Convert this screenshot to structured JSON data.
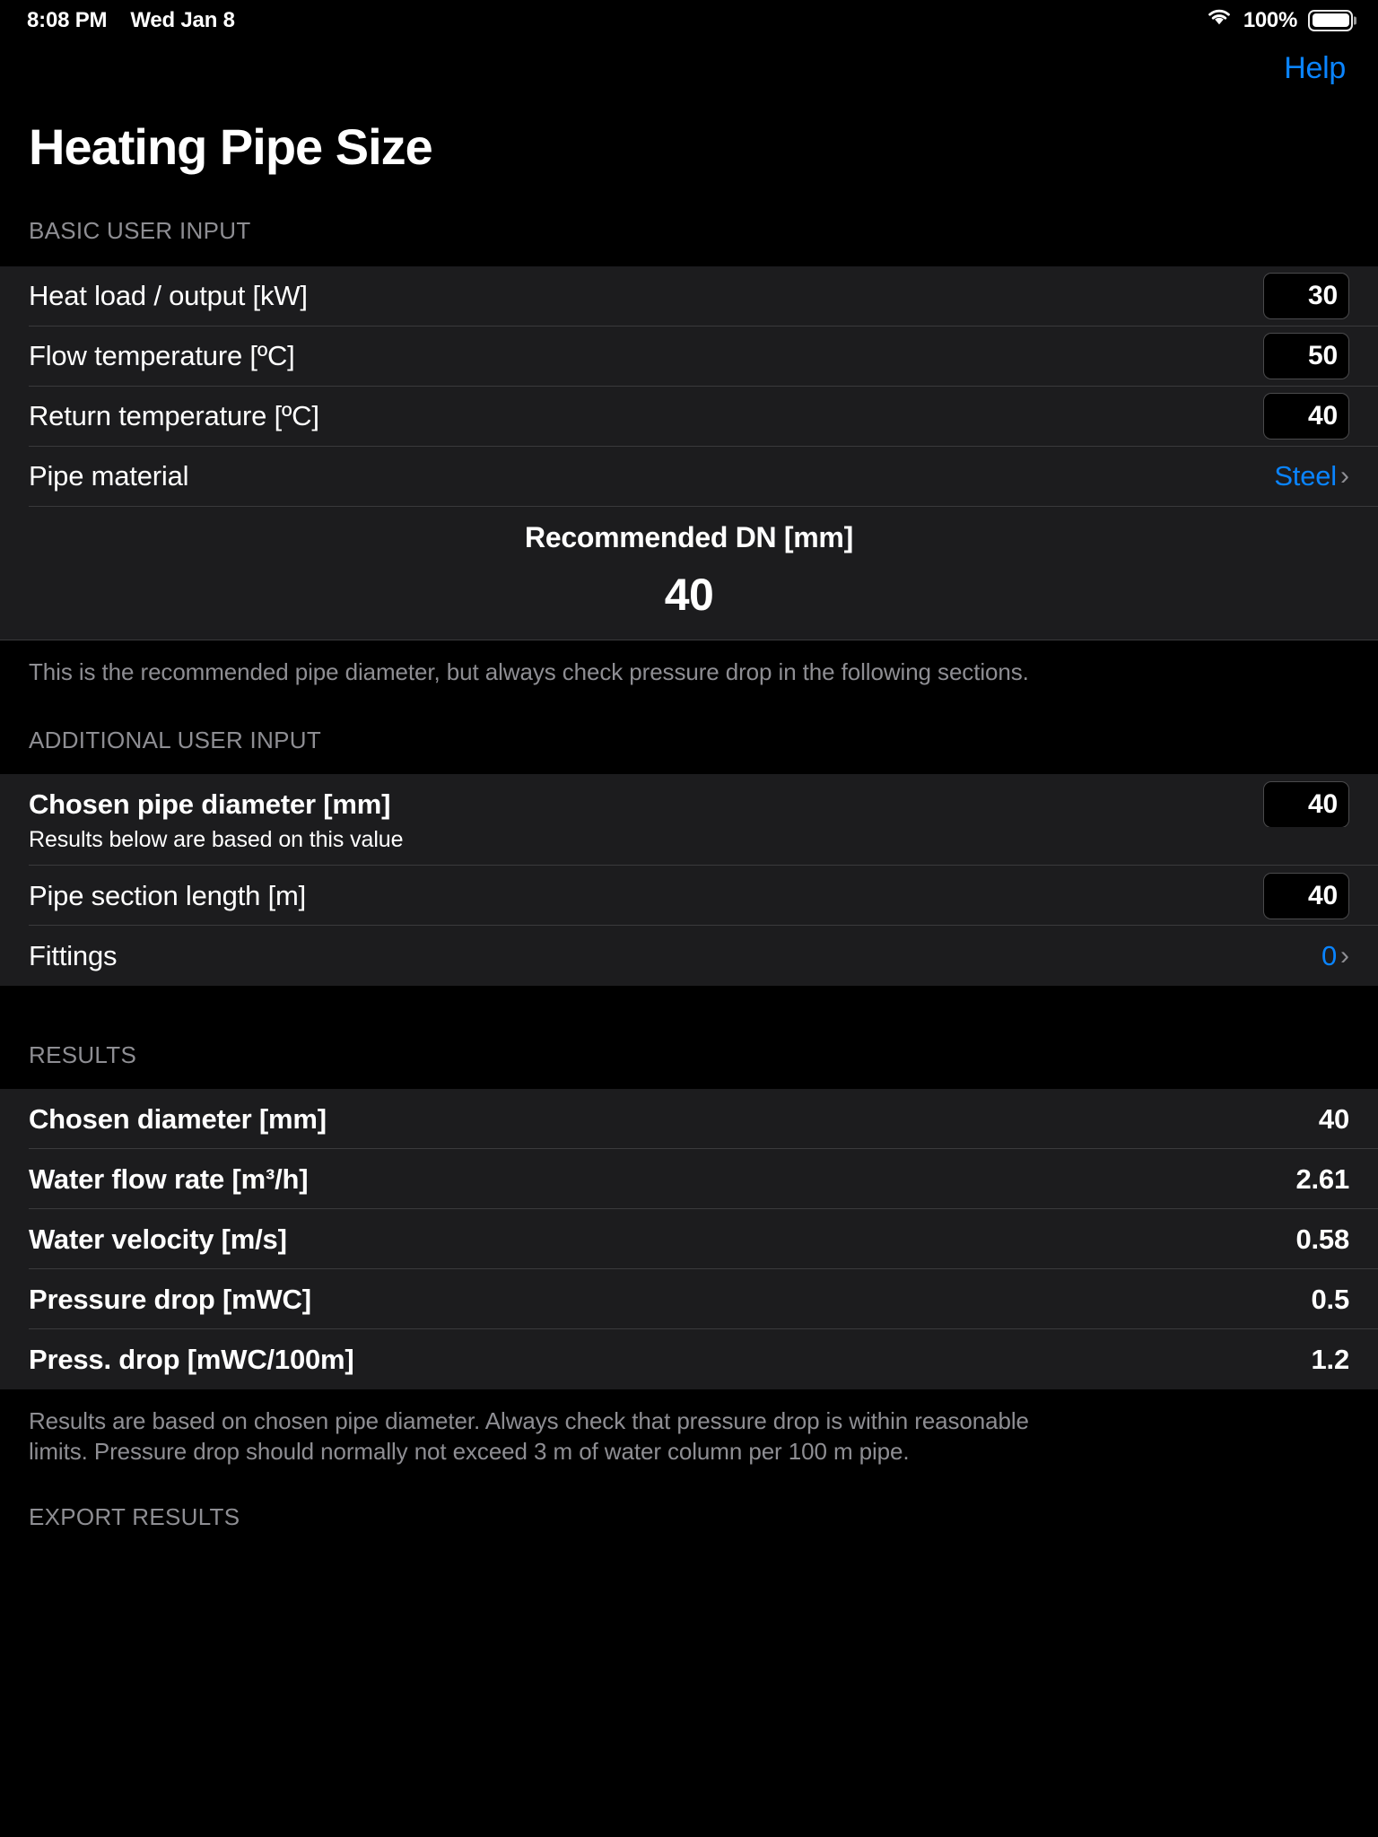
{
  "status_bar": {
    "time": "8:08 PM",
    "date": "Wed Jan 8",
    "battery_percent": "100%",
    "wifi_icon": "wifi-icon",
    "battery_icon": "battery-icon"
  },
  "nav": {
    "help_label": "Help"
  },
  "page": {
    "title": "Heating Pipe Size"
  },
  "basic_section": {
    "header": "BASIC USER INPUT",
    "rows": [
      {
        "label": "Heat load / output [kW]",
        "value": "30",
        "type": "field"
      },
      {
        "label": "Flow temperature [ºC]",
        "value": "50",
        "type": "field"
      },
      {
        "label": "Return temperature [ºC]",
        "value": "40",
        "type": "field"
      },
      {
        "label": "Pipe material",
        "value": "Steel",
        "type": "link"
      }
    ],
    "recommendation": {
      "title": "Recommended DN [mm]",
      "value": "40"
    },
    "footnote": "This is the recommended pipe diameter, but always check pressure drop in the following sections."
  },
  "additional_section": {
    "header": "ADDITIONAL USER INPUT",
    "chosen_diameter": {
      "label": "Chosen pipe diameter [mm]",
      "value": "40",
      "note": "Results below are based on this value"
    },
    "rows": [
      {
        "label": "Pipe section length [m]",
        "value": "40",
        "type": "field"
      },
      {
        "label": "Fittings",
        "value": "0",
        "type": "link"
      }
    ]
  },
  "results_section": {
    "header": "RESULTS",
    "rows": [
      {
        "label": "Chosen diameter [mm]",
        "value": "40"
      },
      {
        "label": "Water flow rate [m³/h]",
        "value": "2.61"
      },
      {
        "label": "Water velocity [m/s]",
        "value": "0.58"
      },
      {
        "label": "Pressure drop [mWC]",
        "value": "0.5"
      },
      {
        "label": "Press. drop [mWC/100m]",
        "value": "1.2"
      }
    ],
    "footnote": "Results are based on chosen pipe diameter. Always check that pressure drop is within reasonable limits. Pressure drop should normally not exceed 3 m of water column per 100 m pipe."
  },
  "export_section": {
    "header": "EXPORT RESULTS"
  },
  "colors": {
    "accent": "#0a84ff",
    "background": "#000000",
    "row_background": "#1c1c1e",
    "separator": "#3a3a3c",
    "secondary_text": "#8e8e93"
  }
}
